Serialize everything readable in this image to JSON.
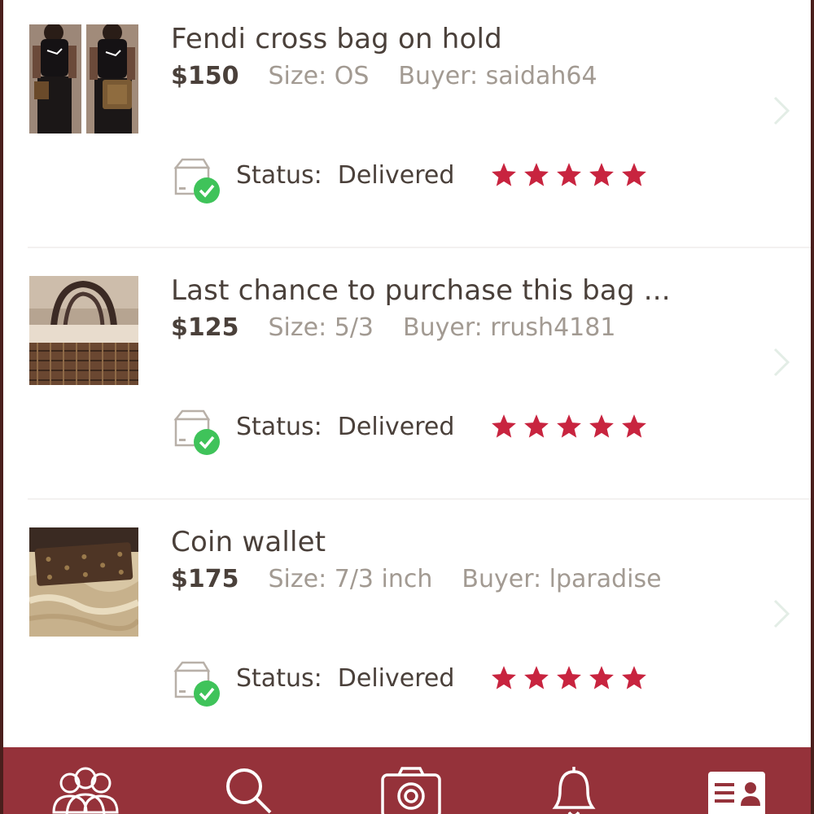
{
  "sales": [
    {
      "title": "Fendi cross bag on hold",
      "price": "$150",
      "size": "Size: OS",
      "buyer": "Buyer: saidah64",
      "status_label": "Status:",
      "status_value": "Delivered",
      "rating": 5,
      "thumbnail_icon": "photo-two-women-crossbody-bag"
    },
    {
      "title": "Last chance to purchase this bag ...",
      "price": "$125",
      "size": "Size: 5/3",
      "buyer": "Buyer: rrush4181",
      "status_label": "Status:",
      "status_value": "Delivered",
      "rating": 5,
      "thumbnail_icon": "photo-monogram-handbag"
    },
    {
      "title": "Coin wallet",
      "price": "$175",
      "size": "Size: 7/3 inch",
      "buyer": "Buyer: lparadise",
      "status_label": "Status:",
      "status_value": "Delivered",
      "rating": 5,
      "thumbnail_icon": "photo-monogram-wallet"
    }
  ],
  "tabbar": {
    "tabs": [
      {
        "icon": "people-icon"
      },
      {
        "icon": "search-icon"
      },
      {
        "icon": "camera-icon"
      },
      {
        "icon": "bell-icon"
      },
      {
        "icon": "profile-card-icon",
        "active": true
      }
    ]
  },
  "colors": {
    "tabbar_bg": "#95323a",
    "star": "#c8243f",
    "check_badge": "#3fc35a",
    "title_text": "#4a403a",
    "meta_text": "#a29a92"
  }
}
